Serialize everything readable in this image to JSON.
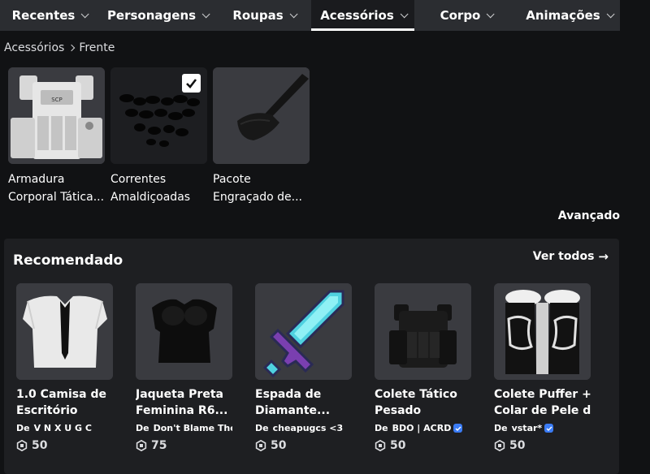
{
  "nav": {
    "tabs": [
      {
        "label": "Recentes",
        "active": false
      },
      {
        "label": "Personagens",
        "active": false
      },
      {
        "label": "Roupas",
        "active": false
      },
      {
        "label": "Acessórios",
        "active": true
      },
      {
        "label": "Corpo",
        "active": false
      },
      {
        "label": "Animações",
        "active": false
      }
    ]
  },
  "breadcrumb": {
    "parent": "Acessórios",
    "current": "Frente"
  },
  "equipped": [
    {
      "line1": "Armadura",
      "line2": "Corporal Tática...",
      "icon": "tactical-vest-icon",
      "checked": false
    },
    {
      "line1": "Correntes",
      "line2": "Amaldiçoadas",
      "icon": "chains-icon",
      "checked": true
    },
    {
      "line1": "Pacote",
      "line2": "Engraçado de...",
      "icon": "bag-icon",
      "checked": false
    }
  ],
  "advanced_label": "Avançado",
  "recommended": {
    "title": "Recomendado",
    "see_all": "Ver todos",
    "items": [
      {
        "line1": "1.0 Camisa de",
        "line2": "Escritório",
        "by": "De",
        "creator": "V N X  U G C",
        "verified": false,
        "price": "50"
      },
      {
        "line1": "Jaqueta Preta",
        "line2": "Feminina R6...",
        "by": "De",
        "creator": "Don't Blame The ...",
        "verified": false,
        "price": "75"
      },
      {
        "line1": "Espada de",
        "line2": "Diamante...",
        "by": "De",
        "creator": "cheapugcs <3",
        "verified": false,
        "price": "50"
      },
      {
        "line1": "Colete Tático",
        "line2": "Pesado",
        "by": "De",
        "creator": "BDO | ACRD",
        "verified": true,
        "price": "50"
      },
      {
        "line1": "Colete Puffer +",
        "line2": "Colar de Pele d...",
        "by": "De",
        "creator": "vstar*",
        "verified": true,
        "price": "50"
      }
    ]
  },
  "colors": {
    "accent_verified": "#3b7cf5",
    "nav_bg": "#2b2d31",
    "page_bg": "#111214"
  }
}
